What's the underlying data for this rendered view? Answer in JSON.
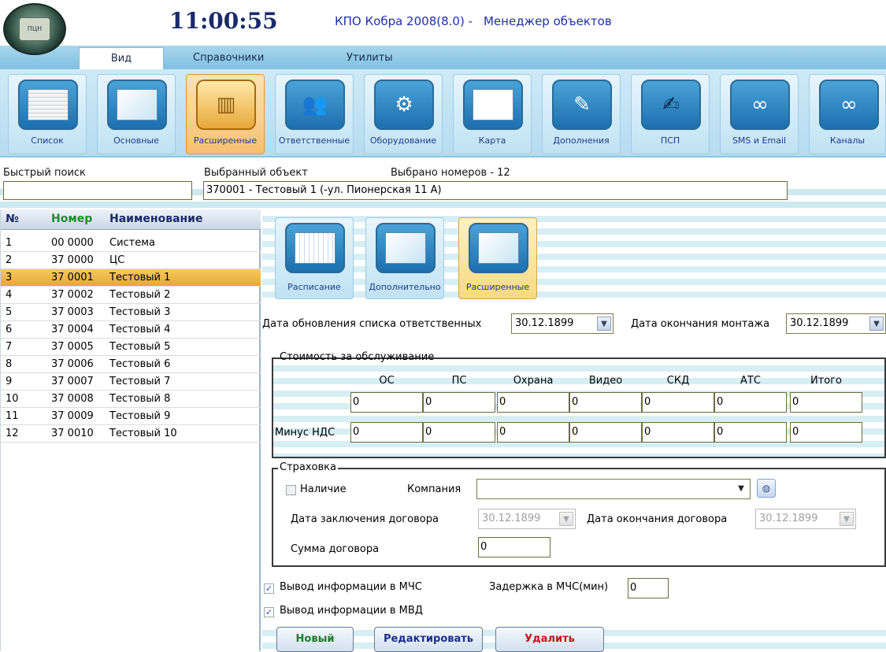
{
  "header": {
    "logo_text": "ПЦН",
    "clock": "11:00:55",
    "title_part1": "КПО Кобра 2008(8.0) -",
    "title_part2": "Менеджер объектов"
  },
  "menu": {
    "tabs": [
      "Вид",
      "Справочники",
      "Утилиты"
    ],
    "active": "Вид"
  },
  "toolbar": {
    "items": [
      {
        "label": "Список",
        "icon": "list-icon"
      },
      {
        "label": "Основные",
        "icon": "main-icon"
      },
      {
        "label": "Расширенные",
        "icon": "folder-icon",
        "active": true
      },
      {
        "label": "Ответственные",
        "icon": "people-icon"
      },
      {
        "label": "Оборудование",
        "icon": "equipment-icon"
      },
      {
        "label": "Карта",
        "icon": "map-icon"
      },
      {
        "label": "Дополнения",
        "icon": "notes-icon"
      },
      {
        "label": "ПСП",
        "icon": "signature-icon"
      },
      {
        "label": "SMS и Email",
        "icon": "sms-icon"
      },
      {
        "label": "Каналы",
        "icon": "channels-icon"
      }
    ]
  },
  "search": {
    "quick_label": "Быстрый поиск",
    "quick_value": "",
    "selected_label": "Выбранный объект",
    "selected_count": "Выбрано номеров - 12",
    "selected_value": "370001 - Тестовый 1 (-ул. Пионерская 11 А)"
  },
  "list": {
    "headers": {
      "no": "№",
      "num": "Номер",
      "name": "Наименование"
    },
    "rows": [
      {
        "no": "1",
        "num": "00 0000",
        "name": "Система"
      },
      {
        "no": "2",
        "num": "37 0000",
        "name": "ЦС"
      },
      {
        "no": "3",
        "num": "37 0001",
        "name": "Тестовый 1"
      },
      {
        "no": "4",
        "num": "37 0002",
        "name": "Тестовый 2"
      },
      {
        "no": "5",
        "num": "37 0003",
        "name": "Тестовый 3"
      },
      {
        "no": "6",
        "num": "37 0004",
        "name": "Тестовый 4"
      },
      {
        "no": "7",
        "num": "37 0005",
        "name": "Тестовый 5"
      },
      {
        "no": "8",
        "num": "37 0006",
        "name": "Тестовый 6"
      },
      {
        "no": "9",
        "num": "37 0007",
        "name": "Тестовый 7"
      },
      {
        "no": "10",
        "num": "37 0008",
        "name": "Тестовый 8"
      },
      {
        "no": "11",
        "num": "37 0009",
        "name": "Тестовый 9"
      },
      {
        "no": "12",
        "num": "37 0010",
        "name": "Тестовый 10"
      }
    ],
    "selected_index": 2
  },
  "subtabs": {
    "items": [
      {
        "label": "Расписание",
        "icon": "schedule-icon"
      },
      {
        "label": "Дополнительно",
        "icon": "extra-icon"
      },
      {
        "label": "Расширенные",
        "icon": "extended-icon",
        "active": true
      }
    ]
  },
  "dates": {
    "update_label": "Дата обновления списка ответственных",
    "update_value": "30.12.1899",
    "install_label": "Дата окончания монтажа",
    "install_value": "30.12.1899"
  },
  "cost": {
    "title": "Стоимость за обслуживание",
    "columns": [
      "ОС",
      "ПС",
      "Охрана",
      "Видео",
      "СКД",
      "АТС",
      "Итого"
    ],
    "row1": [
      "0",
      "0",
      "0",
      "0",
      "0",
      "0",
      "0"
    ],
    "row2_label": "Минус НДС",
    "row2": [
      "0",
      "0",
      "0",
      "0",
      "0",
      "0",
      "0"
    ]
  },
  "insurance": {
    "title": "Страховка",
    "presence_label": "Наличие",
    "company_label": "Компания",
    "company_value": "",
    "contract_date_label": "Дата заключения договора",
    "contract_date_value": "30.12.1899",
    "contract_end_label": "Дата окончания договора",
    "contract_end_value": "30.12.1899",
    "amount_label": "Сумма  договора",
    "amount_value": "0"
  },
  "options": {
    "mchs_label": "Вывод информации в МЧС",
    "mchs_checked": true,
    "delay_label": "Задержка в МЧС(мин)",
    "delay_value": "0",
    "mvd_label": "Вывод информации в МВД",
    "mvd_checked": true
  },
  "actions": {
    "new": "Новый",
    "edit": "Редактировать",
    "delete": "Удалить"
  },
  "colors": {
    "new": "#1f7a2a",
    "edit": "#1b2f8a",
    "delete": "#c01818",
    "selected_row": "#f0b848"
  }
}
